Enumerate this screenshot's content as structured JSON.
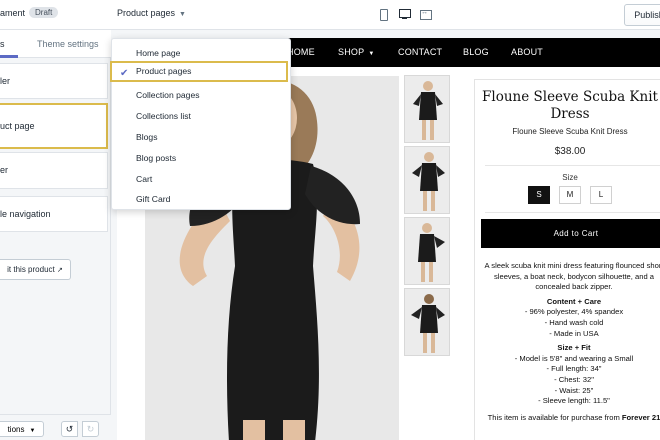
{
  "topbar": {
    "store_name": "ament",
    "status_badge": "Draft",
    "page_selector": "Product pages",
    "publish_label": "Publish",
    "device_icons": [
      "mobile-icon",
      "desktop-icon",
      "fullscreen-icon"
    ]
  },
  "sidebar": {
    "tabs": [
      {
        "label": "s",
        "active": true
      },
      {
        "label": "Theme settings",
        "active": false
      }
    ],
    "sections": [
      {
        "label": "ler"
      },
      {
        "label": "uct page",
        "active": true
      },
      {
        "label": "er"
      },
      {
        "label": "le navigation"
      }
    ],
    "edit_product_label": "it this product",
    "footer_sections_label": "tions"
  },
  "dropdown": {
    "items": [
      {
        "label": "Home page",
        "selected": false
      },
      {
        "label": "Product pages",
        "selected": true
      },
      {
        "label": "Collection pages",
        "selected": false
      },
      {
        "label": "Collections list",
        "selected": false
      },
      {
        "label": "Blogs",
        "selected": false
      },
      {
        "label": "Blog posts",
        "selected": false
      },
      {
        "label": "Cart",
        "selected": false
      },
      {
        "label": "Gift Card",
        "selected": false
      }
    ]
  },
  "store": {
    "nav": [
      "HOME",
      "SHOP",
      "CONTACT",
      "BLOG",
      "ABOUT"
    ],
    "product": {
      "title": "Floune Sleeve Scuba Knit Dress",
      "subtitle": "Floune Sleeve Scuba Knit Dress",
      "price": "$38.00",
      "size_label": "Size",
      "sizes": [
        "S",
        "M",
        "L"
      ],
      "selected_size": "S",
      "add_to_cart": "Add to Cart",
      "description": "A sleek scuba knit mini dress featuring flounced short sleeves, a boat neck, bodycon silhouette, and a concealed back zipper.",
      "care_heading": "Content + Care",
      "care": [
        "- 96% polyester, 4% spandex",
        "- Hand wash cold",
        "- Made in USA"
      ],
      "fit_heading": "Size + Fit",
      "fit": [
        "- Model is 5'8\" and wearing a Small",
        "- Full length: 34\"",
        "- Chest: 32\"",
        "- Waist: 25\"",
        "- Sleeve length: 11.5\""
      ],
      "availability_prefix": "This item is available for purchase from",
      "availability_brand": "Forever 21"
    }
  },
  "colors": {
    "accent": "#5c6ac4",
    "highlight": "#dbbb4c",
    "nav_bg": "#000000"
  }
}
